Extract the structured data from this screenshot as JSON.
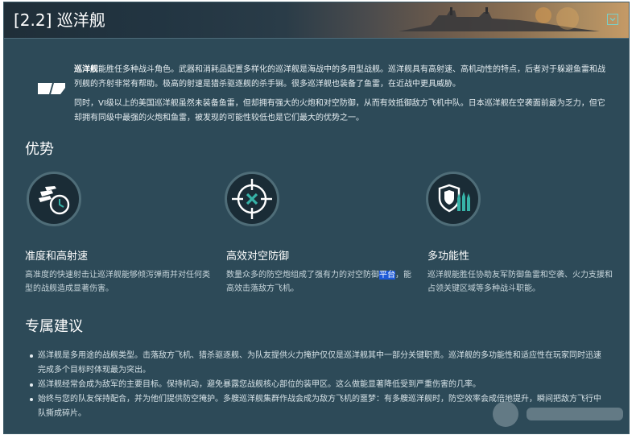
{
  "header": {
    "title": "[2.2] 巡洋舰"
  },
  "intro": {
    "lead": "巡洋舰",
    "p1_rest": "能胜任多种战斗角色。武器和消耗品配置多样化的巡洋舰是海战中的多用型战舰。巡洋舰具有高射速、高机动性的特点，后者对于躲避鱼雷和战列舰的齐射非常有帮助。极高的射速是猎杀驱逐舰的杀手锏。很多巡洋舰也装备了鱼雷，在近战中更具威胁。",
    "p2": "同时，VI级以上的美国巡洋舰虽然未装备鱼雷，但却拥有强大的火炮和对空防御，从而有效抵御敌方飞机中队。日本巡洋舰在空袭面前最为乏力，但它却拥有同级中最强的火炮和鱼雷，被发现的可能性较低也是它们最大的优势之一。"
  },
  "advantages": {
    "title": "优势",
    "items": [
      {
        "icon": "clock-shells-icon",
        "title": "准度和高射速",
        "desc": "高准度的快速射击让巡洋舰能够倾泻弹雨并对任何类型的战舰造成显著伤害。"
      },
      {
        "icon": "crosshair-plane-icon",
        "title": "高效对空防御",
        "desc_before": "数量众多的防空炮组成了强有力的对空防御",
        "desc_highlight": "平台",
        "desc_after": "，能高效击落敌方飞机。"
      },
      {
        "icon": "shield-shells-icon",
        "title": "多功能性",
        "desc": "巡洋舰能胜任协助友军防御鱼雷和空袭、火力支援和占领关键区域等多种战斗职能。"
      }
    ]
  },
  "tips": {
    "title": "专属建议",
    "items": [
      "巡洋舰是多用途的战舰类型。击落敌方飞机、猎杀驱逐舰、为队友提供火力掩护仅仅是巡洋舰其中一部分关键职责。巡洋舰的多功能性和适应性在玩家同时迅速完成多个目标时体现最为突出。",
      "巡洋舰经常会成为敌军的主要目标。保持机动，避免暴露您战舰核心部位的装甲区。这么做能显著降低受到严重伤害的几率。",
      "始终与您的队友保持配合，并为他们提供防空掩护。多艘巡洋舰集群作战会成为敌方飞机的噩梦：有多艘巡洋舰时，防空效率会成倍地提升，瞬间把敌方飞行中队撕成碎片。"
    ]
  },
  "colors": {
    "panel_bg": "#2d4a58",
    "accent": "#37b3a8",
    "highlight": "#1e5ad8"
  }
}
